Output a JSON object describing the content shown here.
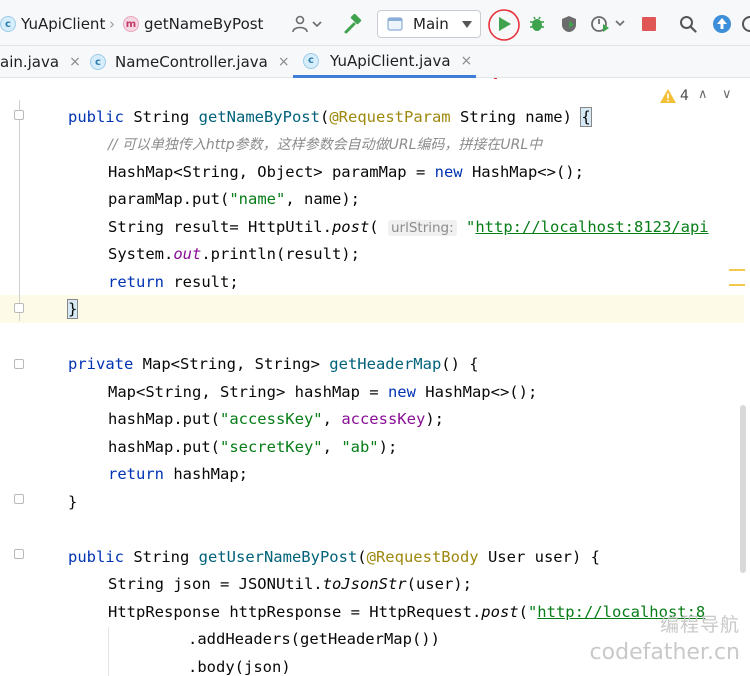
{
  "breadcrumb": {
    "project": "YuApiClient",
    "method": "getNameByPost"
  },
  "toolbar": {
    "run_config": "Main",
    "icons": [
      "user-icon",
      "build-hammer-icon",
      "run-icon",
      "debug-icon",
      "coverage-icon",
      "profiler-icon",
      "stop-icon",
      "search-icon",
      "update-icon",
      "settings-icon"
    ],
    "accent_run": "#3fa34d",
    "accent_stop": "#e05555",
    "accent_update": "#3d8fd9"
  },
  "tabs": [
    {
      "label": "ain.java",
      "close": "×"
    },
    {
      "label": "NameController.java",
      "close": "×"
    },
    {
      "label": "YuApiClient.java",
      "close": "×"
    }
  ],
  "editor": {
    "warnings_count": "4",
    "up": "∧",
    "down": "∨",
    "lines": [
      [
        "public ",
        "String ",
        "getNameByPost",
        "(",
        "@RequestParam ",
        "String name) ",
        "{"
      ],
      [
        "// 可以单独传入http参数，这样参数会自动做URL编码，拼接在URL中"
      ],
      [
        "HashMap<String, Object> paramMap = ",
        "new ",
        "HashMap<>();"
      ],
      [
        "paramMap.put(",
        "\"name\"",
        ", name);"
      ],
      [
        "String result= HttpUtil.",
        "post",
        "( ",
        "urlString:",
        " \"",
        "http://localhost:8123/api"
      ],
      [
        "System.",
        "out",
        ".println(result);"
      ],
      [
        "return ",
        "result;"
      ],
      [
        "}"
      ],
      [
        "private ",
        "Map<String, String> ",
        "getHeaderMap",
        "() {"
      ],
      [
        "Map<String, String> hashMap = ",
        "new ",
        "HashMap<>();"
      ],
      [
        "hashMap.put(",
        "\"accessKey\"",
        ", ",
        "accessKey",
        ");"
      ],
      [
        "hashMap.put(",
        "\"secretKey\"",
        ", ",
        "\"ab\"",
        ");"
      ],
      [
        "return ",
        "hashMap;"
      ],
      [
        "}"
      ],
      [
        "public ",
        "String ",
        "getUserNameByPost",
        "(",
        "@RequestBody ",
        "User user) {"
      ],
      [
        "String json = JSONUtil.",
        "toJsonStr",
        "(user);"
      ],
      [
        "HttpResponse httpResponse = HttpRequest.",
        "post",
        "(",
        "\"",
        "http://localhost:8"
      ],
      [
        ".addHeaders(getHeaderMap())"
      ],
      [
        ".body(json)"
      ]
    ]
  },
  "watermark": {
    "line1": "编程导航",
    "line2": "codefather.cn"
  }
}
